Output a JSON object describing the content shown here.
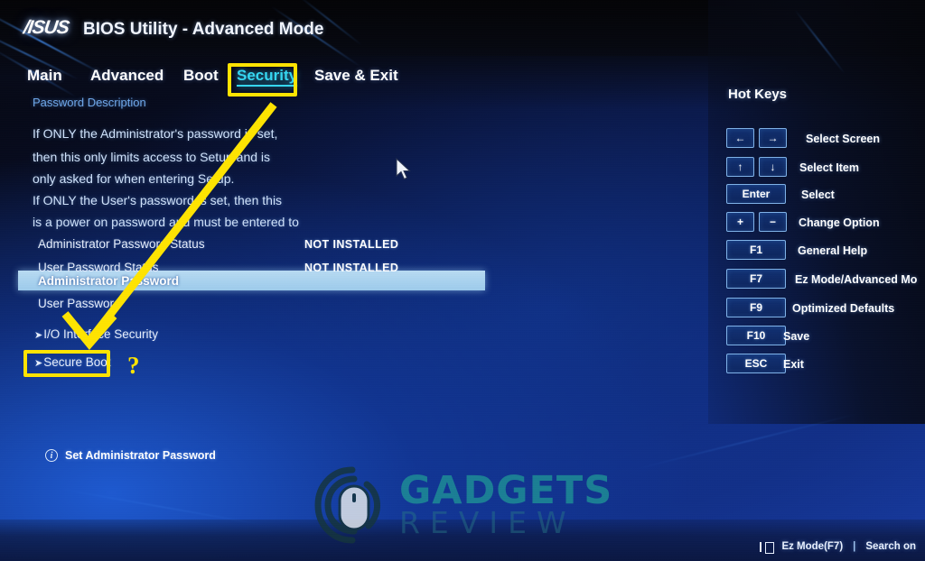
{
  "brand": "/ISUS",
  "header": {
    "title": "BIOS Utility - Advanced Mode"
  },
  "tabs": [
    {
      "id": "main",
      "label": "Main",
      "active": false
    },
    {
      "id": "advanced",
      "label": "Advanced",
      "active": false
    },
    {
      "id": "boot",
      "label": "Boot",
      "active": false
    },
    {
      "id": "security",
      "label": "Security",
      "active": true
    },
    {
      "id": "saveexit",
      "label": "Save & Exit",
      "active": false
    }
  ],
  "main": {
    "description_title": "Password Description",
    "description_lines": [
      "If ONLY the Administrator's password is set,",
      "then this only limits access to Setup and is",
      "only asked for when entering Setup.",
      "If ONLY the User's password is set, then this",
      "is a power on password and must be entered to"
    ],
    "rows": [
      {
        "label": "Administrator Password Status",
        "value": "NOT INSTALLED",
        "highlighted": false,
        "submenu": false
      },
      {
        "label": "User Password Status",
        "value": "NOT INSTALLED",
        "highlighted": false,
        "submenu": false
      },
      {
        "label": "Administrator Password",
        "value": "",
        "highlighted": true,
        "submenu": false
      },
      {
        "label": "User Password",
        "value": "",
        "highlighted": false,
        "submenu": false
      },
      {
        "label": "I/O Interface Security",
        "value": "",
        "highlighted": false,
        "submenu": true
      },
      {
        "label": "Secure Boot",
        "value": "",
        "highlighted": false,
        "submenu": true
      }
    ],
    "submenu_marker": "➤",
    "annotation_question": "?"
  },
  "hotkeys": {
    "title": "Hot Keys",
    "items": [
      {
        "keys": [
          "←",
          "→"
        ],
        "desc": "Select Screen"
      },
      {
        "keys": [
          "↑",
          "↓"
        ],
        "desc": "Select Item"
      },
      {
        "keys": [
          "Enter"
        ],
        "desc": "Select"
      },
      {
        "keys": [
          "+",
          "−"
        ],
        "desc": "Change Option"
      },
      {
        "keys": [
          "F1"
        ],
        "desc": "General Help"
      },
      {
        "keys": [
          "F7"
        ],
        "desc": "Ez Mode/Advanced Mo"
      },
      {
        "keys": [
          "F9"
        ],
        "desc": "Optimized Defaults"
      },
      {
        "keys": [
          "F10"
        ],
        "desc": "Save"
      },
      {
        "keys": [
          "ESC"
        ],
        "desc": "Exit"
      }
    ]
  },
  "footer": {
    "info_hint": "Set Administrator Password",
    "info_icon": "i",
    "ez_mode": "Ez Mode(F7)",
    "separator": "|",
    "search": "Search on"
  },
  "watermark": {
    "primary": "GADGETS",
    "secondary": "REVIEW"
  },
  "annotations": {
    "highlight_color": "#ffe400",
    "active_tab_color": "#35d8f2",
    "selection_bar_color": "#a8d2ef"
  }
}
